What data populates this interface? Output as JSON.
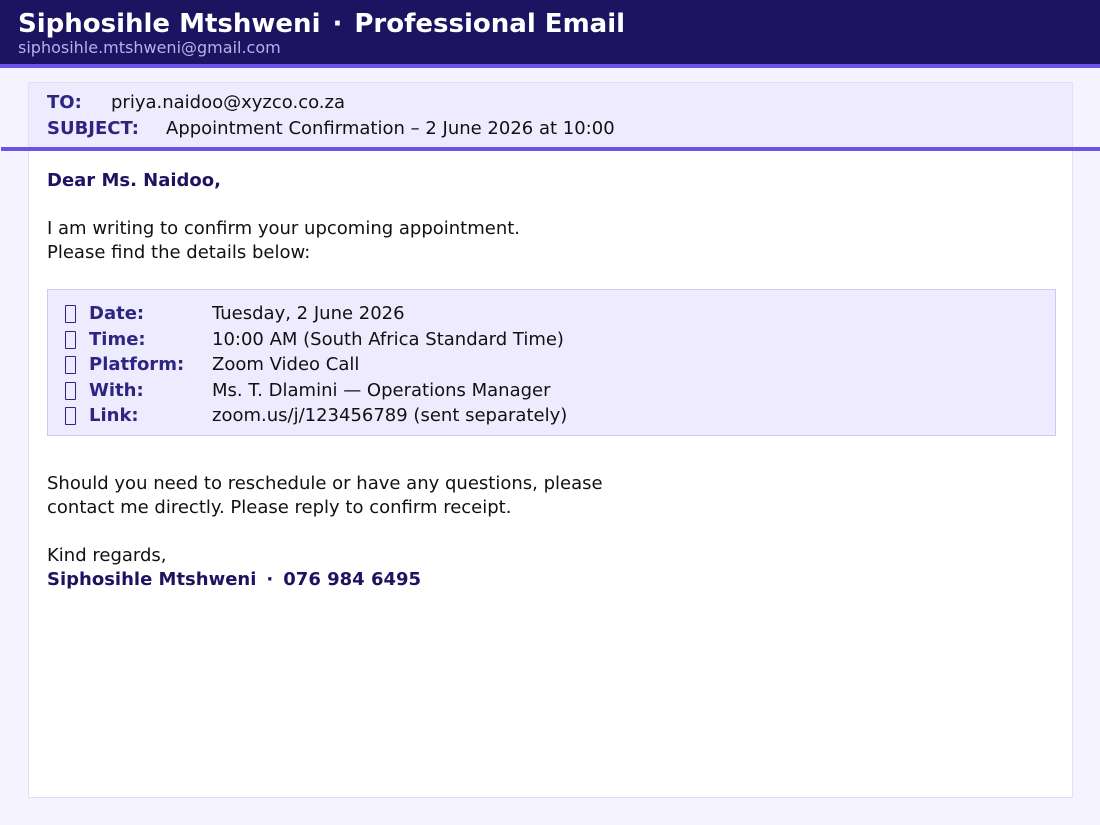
{
  "header": {
    "sender_name": "Siphosihle Mtshweni",
    "separator": "·",
    "app_name": "Professional Email",
    "sender_email": "siphosihle.mtshweni@gmail.com"
  },
  "email": {
    "to_label": "TO:",
    "to_value": "priya.naidoo@xyzco.co.za",
    "subject_label": "SUBJECT:",
    "subject_value": "Appointment Confirmation – 2 June 2026 at 10:00",
    "greeting": "Dear Ms. Naidoo,",
    "intro_line1": "I am writing to confirm your upcoming appointment.",
    "intro_line2": "Please find the details below:",
    "details": [
      {
        "label": "Date:",
        "value": "Tuesday, 2 June 2026",
        "icon": "calendar-icon"
      },
      {
        "label": "Time:",
        "value": "10:00 AM (South Africa Standard Time)",
        "icon": "clock-icon"
      },
      {
        "label": "Platform:",
        "value": "Zoom Video Call",
        "icon": "video-icon"
      },
      {
        "label": "With:",
        "value": "Ms. T. Dlamini — Operations Manager",
        "icon": "person-icon"
      },
      {
        "label": "Link:",
        "value": "zoom.us/j/123456789 (sent separately)",
        "icon": "link-icon"
      }
    ],
    "closing_line1": "Should you need to reschedule or have any questions, please",
    "closing_line2": "contact me directly. Please reply to confirm receipt.",
    "regards": "Kind regards,",
    "signature_name": "Siphosihle Mtshweni",
    "signature_separator": "·",
    "signature_phone": "076 984 6495"
  },
  "colors": {
    "header_bg": "#1c1461",
    "accent": "#6a54e8",
    "label": "#2d2580",
    "panel_bg": "#eeebff"
  }
}
